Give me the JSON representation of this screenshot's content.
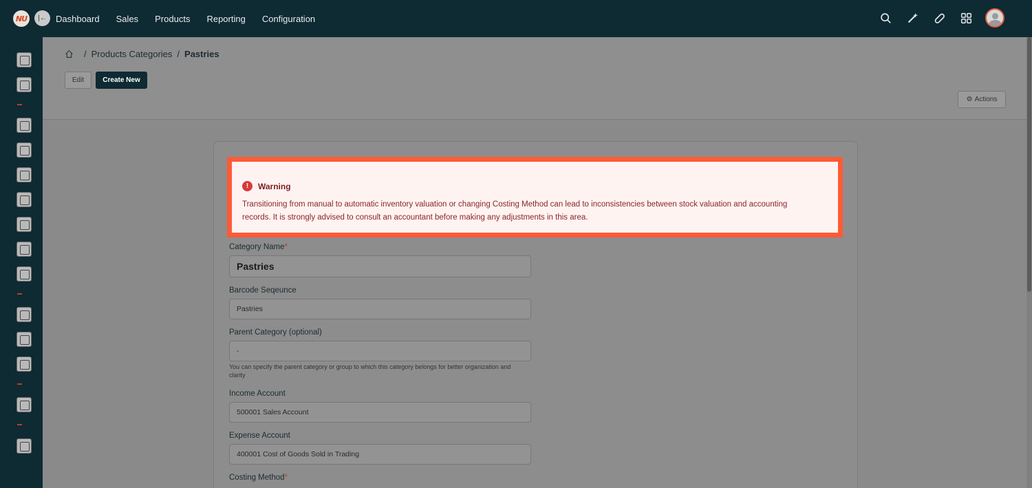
{
  "brand": {
    "logo_text": "NU"
  },
  "nav": {
    "items": [
      "Dashboard",
      "Sales",
      "Products",
      "Reporting",
      "Configuration"
    ]
  },
  "top_icons": [
    "search-icon",
    "magic-wand-icon",
    "bandage-icon",
    "apps-grid-icon",
    "user-avatar"
  ],
  "breadcrumb": {
    "items": [
      "Products Categories",
      "Pastries"
    ],
    "separator": "/"
  },
  "toolbar": {
    "edit_label": "Edit",
    "create_label": "Create New",
    "actions_label": "Actions"
  },
  "warning": {
    "title": "Warning",
    "message": "Transitioning from manual to automatic inventory valuation or changing Costing Method can lead to inconsistencies between stock valuation and accounting records. It is strongly advised to consult an accountant before making any adjustments in this area."
  },
  "form": {
    "category_name": {
      "label": "Category Name",
      "required": "*",
      "value": "Pastries"
    },
    "barcode_sequence": {
      "label": "Barcode Seqeunce",
      "value": "Pastries"
    },
    "parent_category": {
      "label": "Parent Category (optional)",
      "value": "-",
      "help": "You can specify the parent category or group to which this category belongs for better organization and clarity"
    },
    "income_account": {
      "label": "Income Account",
      "value": "500001 Sales Account"
    },
    "expense_account": {
      "label": "Expense Account",
      "value": "400001 Cost of Goods Sold in Trading"
    },
    "costing_method": {
      "label": "Costing Method",
      "required": "*"
    }
  },
  "colors": {
    "topbar": "#0e2a33",
    "highlight": "#ff5a36",
    "warning_bg": "#fff3f2",
    "warning_text": "#8a2626"
  }
}
